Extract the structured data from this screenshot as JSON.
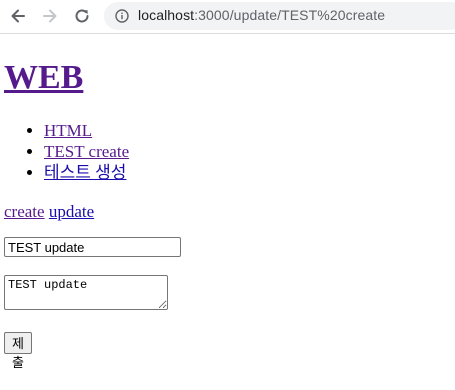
{
  "browser": {
    "url_host": "localhost",
    "url_path": ":3000/update/TEST%20create"
  },
  "page": {
    "site_title": "WEB",
    "topics": [
      {
        "label": "HTML"
      },
      {
        "label": "TEST create"
      },
      {
        "label": "테스트 생성"
      }
    ],
    "controls": {
      "create_label": "create",
      "update_label": "update"
    },
    "form": {
      "title_value": "TEST update",
      "description_value": "TEST update",
      "submit_label": "제출"
    }
  }
}
